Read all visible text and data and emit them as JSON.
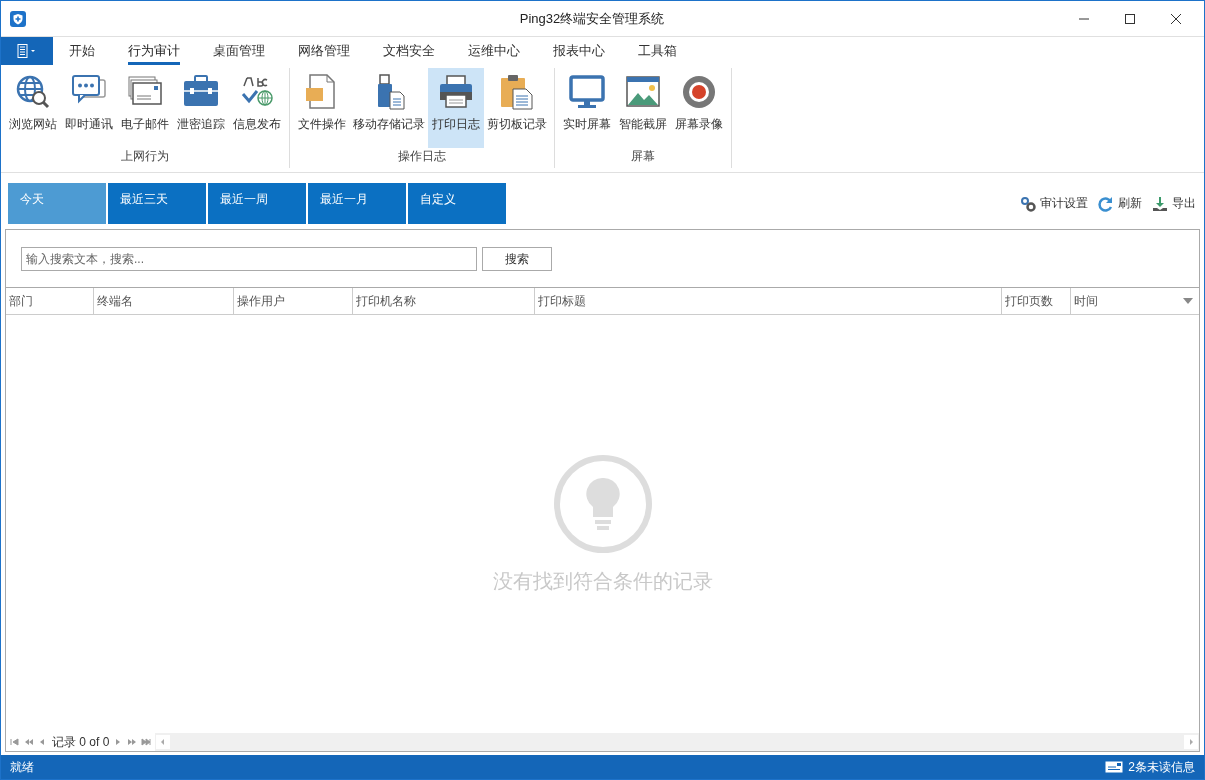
{
  "window": {
    "title": "Ping32终端安全管理系统"
  },
  "ribbon_tabs": [
    {
      "label": "开始",
      "selected": false
    },
    {
      "label": "行为审计",
      "selected": true
    },
    {
      "label": "桌面管理",
      "selected": false
    },
    {
      "label": "网络管理",
      "selected": false
    },
    {
      "label": "文档安全",
      "selected": false
    },
    {
      "label": "运维中心",
      "selected": false
    },
    {
      "label": "报表中心",
      "selected": false
    },
    {
      "label": "工具箱",
      "selected": false
    }
  ],
  "ribbon_groups": [
    {
      "label": "上网行为",
      "buttons": [
        {
          "label": "浏览网站",
          "selected": false
        },
        {
          "label": "即时通讯",
          "selected": false
        },
        {
          "label": "电子邮件",
          "selected": false
        },
        {
          "label": "泄密追踪",
          "selected": false
        },
        {
          "label": "信息发布",
          "selected": false
        }
      ]
    },
    {
      "label": "操作日志",
      "buttons": [
        {
          "label": "文件操作",
          "selected": false
        },
        {
          "label": "移动存储记录",
          "selected": false
        },
        {
          "label": "打印日志",
          "selected": true
        },
        {
          "label": "剪切板记录",
          "selected": false
        }
      ]
    },
    {
      "label": "屏幕",
      "buttons": [
        {
          "label": "实时屏幕",
          "selected": false
        },
        {
          "label": "智能截屏",
          "selected": false
        },
        {
          "label": "屏幕录像",
          "selected": false
        }
      ]
    }
  ],
  "date_tabs": [
    {
      "label": "今天",
      "selected": true
    },
    {
      "label": "最近三天",
      "selected": false
    },
    {
      "label": "最近一周",
      "selected": false
    },
    {
      "label": "最近一月",
      "selected": false
    },
    {
      "label": "自定义",
      "selected": false
    }
  ],
  "actions": [
    "审计设置",
    "刷新",
    "导出"
  ],
  "search": {
    "placeholder": "输入搜索文本，搜索...",
    "button": "搜索"
  },
  "table": {
    "columns": [
      "部门",
      "终端名",
      "操作用户",
      "打印机名称",
      "打印标题",
      "打印页数",
      "时间"
    ],
    "empty_message": "没有找到符合条件的记录"
  },
  "pager": {
    "label": "记录 0 of 0"
  },
  "status_bar": {
    "left": "就绪",
    "right": "2条未读信息"
  }
}
